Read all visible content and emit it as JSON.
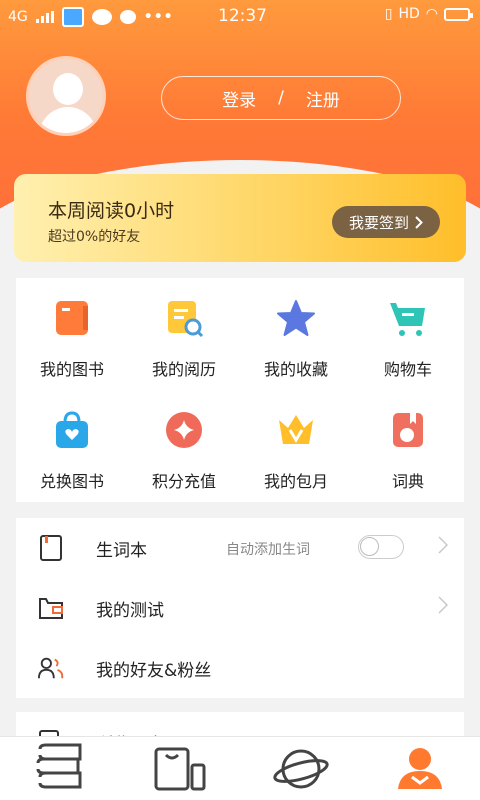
{
  "status_bar": {
    "network": "4G",
    "time": "12:37",
    "hd": "HD"
  },
  "header": {
    "login_label": "登录",
    "separator": "/",
    "register_label": "注册"
  },
  "reading_card": {
    "title": "本周阅读0小时",
    "subtitle": "超过0%的好友",
    "signin_label": "我要签到"
  },
  "grid": [
    {
      "label": "我的图书",
      "icon": "book-icon"
    },
    {
      "label": "我的阅历",
      "icon": "history-doc-icon"
    },
    {
      "label": "我的收藏",
      "icon": "star-icon"
    },
    {
      "label": "购物车",
      "icon": "cart-icon"
    },
    {
      "label": "兑换图书",
      "icon": "shopping-bag-icon"
    },
    {
      "label": "积分充值",
      "icon": "points-icon"
    },
    {
      "label": "我的包月",
      "icon": "crown-icon"
    },
    {
      "label": "词典",
      "icon": "dictionary-icon"
    }
  ],
  "list": {
    "vocab": {
      "label": "生词本",
      "hint": "自动添加生词",
      "toggle_on": false
    },
    "test": {
      "label": "我的测试"
    },
    "friends": {
      "label": "我的好友&粉丝"
    },
    "history": {
      "label": "浏览历史"
    }
  },
  "tabs": [
    {
      "name": "bookshelf-icon",
      "active": false
    },
    {
      "name": "store-icon",
      "active": false
    },
    {
      "name": "planet-icon",
      "active": false
    },
    {
      "name": "profile-icon",
      "active": true
    }
  ],
  "colors": {
    "accent": "#ff7a36",
    "gold": "#ffc83a",
    "active_tab": "#ff7a2f"
  }
}
